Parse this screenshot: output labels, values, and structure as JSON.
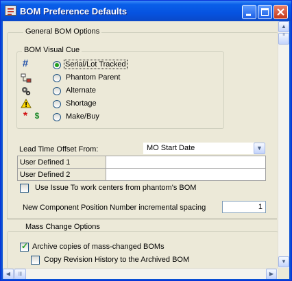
{
  "window": {
    "title": "BOM Preference Defaults"
  },
  "general": {
    "legend": "General BOM Options",
    "visual_cue": {
      "legend": "BOM Visual Cue",
      "options": [
        {
          "icon": "#",
          "label": "Serial/Lot Tracked",
          "selected": true
        },
        {
          "icon": "phantom-parent-icon",
          "label": "Phantom Parent",
          "selected": false
        },
        {
          "icon": "gears-icon",
          "label": "Alternate",
          "selected": false
        },
        {
          "icon": "warning-icon",
          "label": "Shortage",
          "selected": false
        },
        {
          "icon_a": "*",
          "icon_b": "$",
          "label": "Make/Buy",
          "selected": false
        }
      ]
    },
    "lead_time": {
      "label": "Lead Time Offset From:",
      "value": "MO Start Date"
    },
    "user_defined_1": {
      "label": "User Defined 1",
      "value": ""
    },
    "user_defined_2": {
      "label": "User Defined 2",
      "value": ""
    },
    "use_issue_to": {
      "label": "Use Issue To work centers from phantom's BOM",
      "checked": false
    },
    "position_spacing": {
      "label": "New Component Position Number incremental spacing",
      "value": "1"
    }
  },
  "mass_change": {
    "legend": "Mass Change Options",
    "archive": {
      "label": "Archive copies of mass-changed BOMs",
      "checked": true
    },
    "copy_revision": {
      "label": "Copy Revision History to the Archived BOM",
      "checked": false
    }
  },
  "colors": {
    "hash": "#1f4fa8",
    "star": "#d11010",
    "dollar": "#1d8a2a",
    "accent": "#0a5fe9"
  }
}
